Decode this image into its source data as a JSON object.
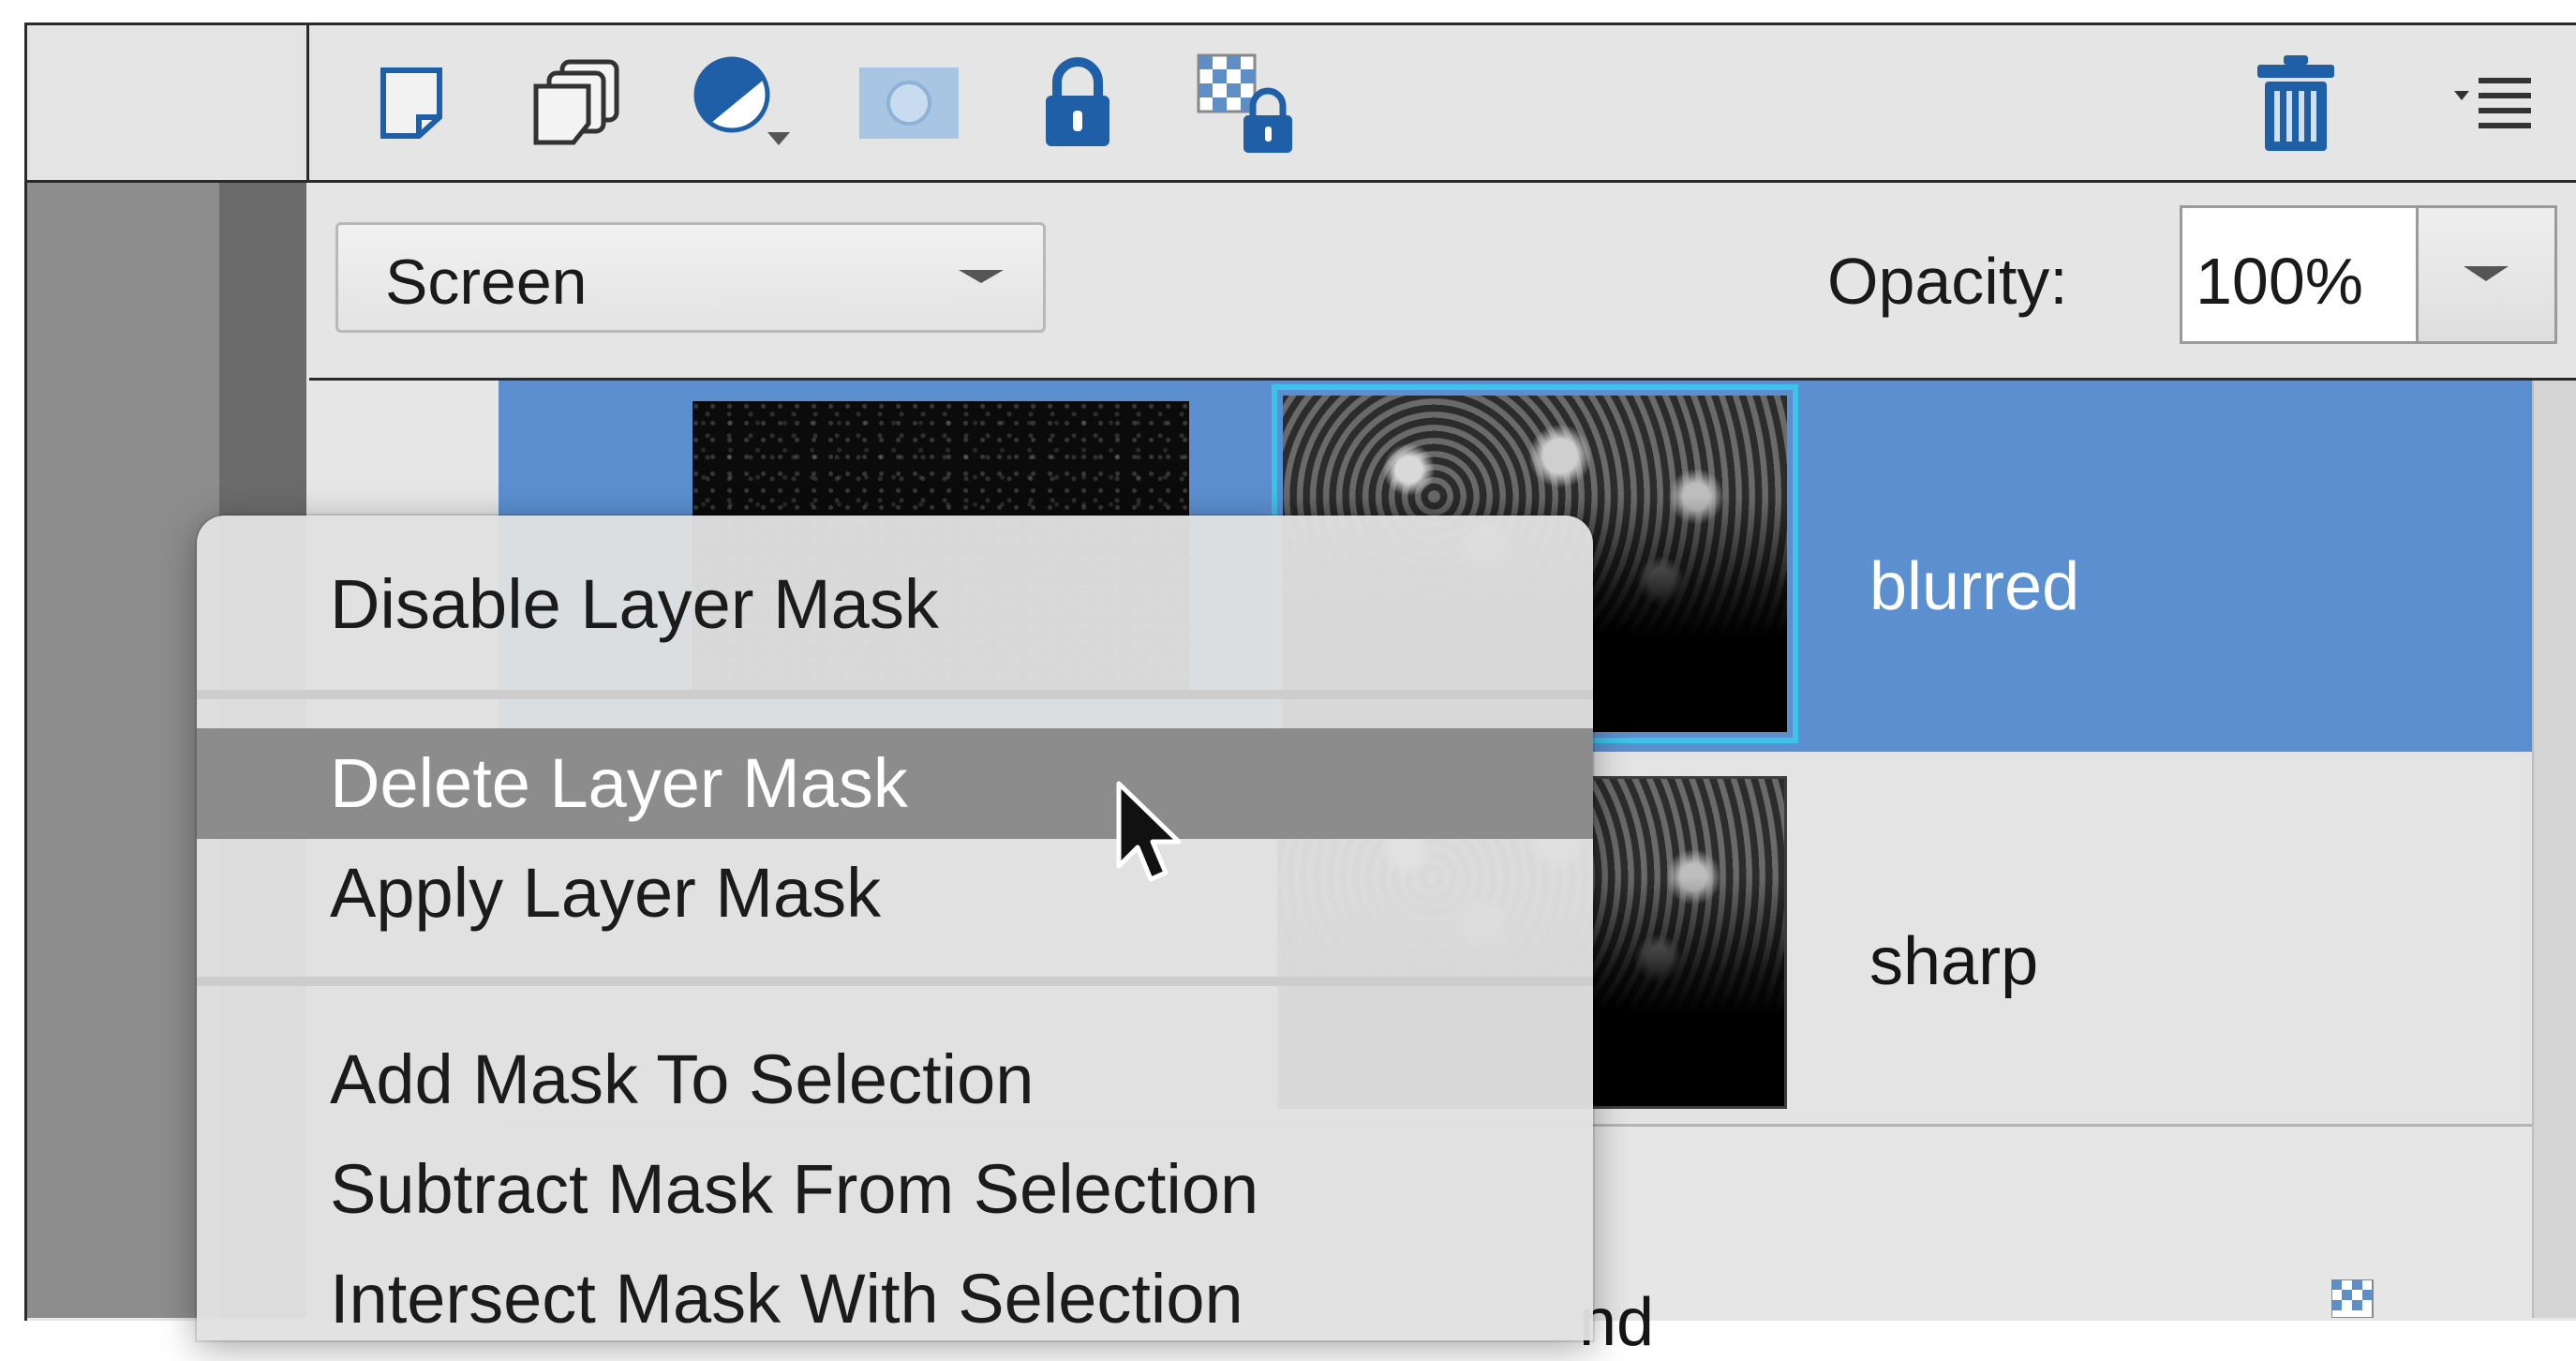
{
  "toolbar": {
    "icons": [
      "new-layer-icon",
      "new-group-icon",
      "adjustment-layer-icon",
      "layer-mask-icon",
      "lock-all-icon",
      "lock-transparency-icon",
      "trash-icon",
      "panel-menu-icon"
    ]
  },
  "blend": {
    "mode": "Screen",
    "opacity_label": "Opacity:",
    "opacity_value": "100%"
  },
  "layers": [
    {
      "name": "blurred",
      "selected": true,
      "has_mask": true
    },
    {
      "name": "sharp",
      "selected": false,
      "has_mask": true
    },
    {
      "name": "nd",
      "selected": false,
      "has_mask": false
    }
  ],
  "context_menu": {
    "items": [
      {
        "label": "Disable Layer Mask",
        "hover": false
      },
      {
        "label": "Delete Layer Mask",
        "hover": true
      },
      {
        "label": "Apply Layer Mask",
        "hover": false
      },
      {
        "label": "Add Mask To Selection",
        "hover": false
      },
      {
        "label": "Subtract Mask From Selection",
        "hover": false
      },
      {
        "label": "Intersect Mask With Selection",
        "hover": false
      }
    ]
  },
  "colors": {
    "selected_layer": "#5b8fd0",
    "menu_hover": "#8c8c8c",
    "mask_border": "#3ec1ea",
    "icon_blue": "#1f5fa8"
  }
}
